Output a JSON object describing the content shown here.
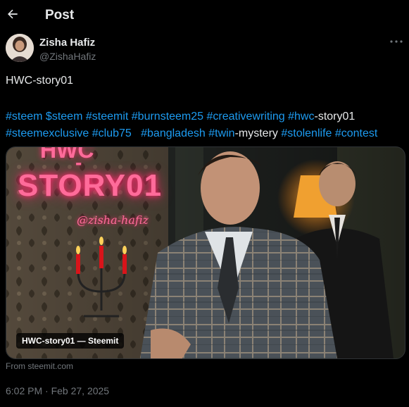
{
  "header": {
    "title": "Post"
  },
  "author": {
    "name": "Zisha Hafiz",
    "handle": "@ZishaHafiz"
  },
  "post": {
    "text": "HWC-story01",
    "hashtags_line1": [
      {
        "t": "#steem",
        "h": true
      },
      {
        "t": " ",
        "h": false
      },
      {
        "t": "$steem",
        "h": true
      },
      {
        "t": " ",
        "h": false
      },
      {
        "t": "#steemit",
        "h": true
      },
      {
        "t": " ",
        "h": false
      },
      {
        "t": "#burnsteem25",
        "h": true
      },
      {
        "t": " ",
        "h": false
      },
      {
        "t": "#creativewriting",
        "h": true
      },
      {
        "t": " ",
        "h": false
      },
      {
        "t": "#hwc",
        "h": true
      },
      {
        "t": "-story01",
        "h": false
      }
    ],
    "hashtags_line2": [
      {
        "t": "#steemexclusive",
        "h": true
      },
      {
        "t": " ",
        "h": false
      },
      {
        "t": "#club75",
        "h": true
      },
      {
        "t": "   ",
        "h": false
      },
      {
        "t": "#bangladesh",
        "h": true
      },
      {
        "t": " ",
        "h": false
      },
      {
        "t": "#twin",
        "h": true
      },
      {
        "t": "-mystery ",
        "h": false
      },
      {
        "t": "#stolenlife",
        "h": true
      },
      {
        "t": " ",
        "h": false
      },
      {
        "t": "#contest",
        "h": true
      }
    ]
  },
  "card": {
    "label": "HWC-story01 — Steemit",
    "image_text_top": "HWC",
    "image_text_dash": "-",
    "image_title": "STORY01",
    "image_handle": "@zisha-hafiz"
  },
  "source": "From steemit.com",
  "timestamp": "6:02 PM · Feb 27, 2025",
  "icons": {
    "back": "arrow-left-icon",
    "more": "more-horizontal-icon"
  },
  "colors": {
    "link": "#1d9bf0",
    "muted": "#71767b",
    "text": "#e7e9ea",
    "neon": "#ff6b9a"
  }
}
